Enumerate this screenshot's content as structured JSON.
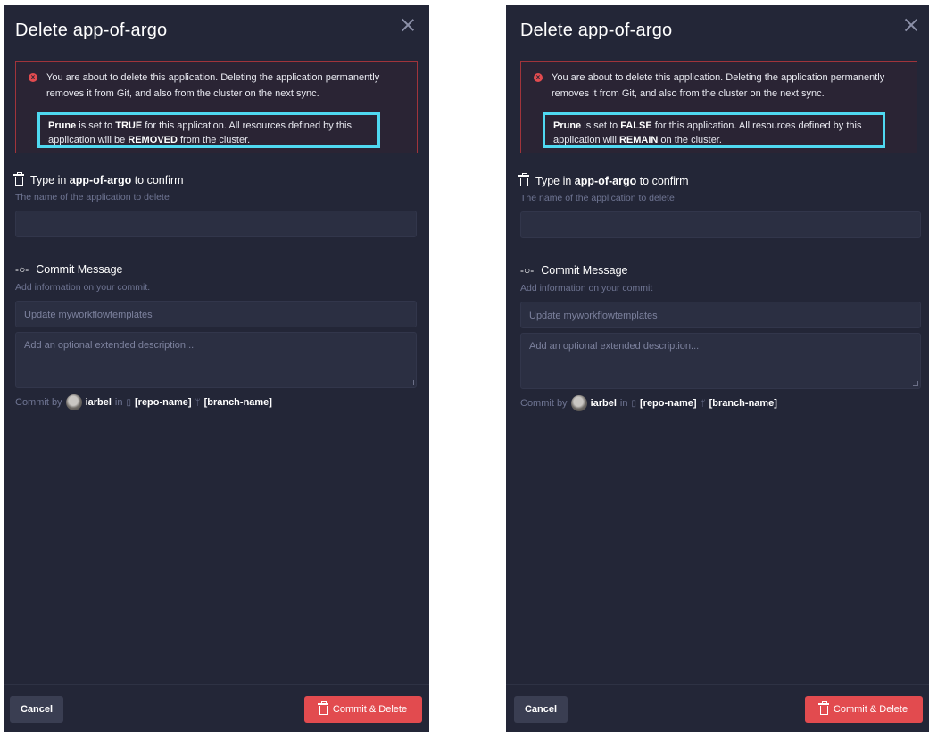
{
  "dialogs": [
    {
      "title": "Delete app-of-argo",
      "alert": {
        "message": "You are about to delete this application. Deleting the application permanently removes it from Git, and also from the cluster on the next sync.",
        "prune_label": "Prune",
        "prune_mid": " is set to ",
        "prune_value": "TRUE",
        "prune_after": " for this application. All resources defined by this application will be ",
        "prune_effect": "REMOVED",
        "prune_tail": " from the cluster."
      },
      "confirm": {
        "prefix": "Type in ",
        "app_name": "app-of-argo",
        "suffix": " to confirm",
        "hint": "The name of the application to delete",
        "value": ""
      },
      "commit": {
        "heading": "Commit Message",
        "hint": "Add information on your commit.",
        "summary_placeholder": "Update myworkflowtemplates",
        "description_placeholder": "Add an optional extended description...",
        "by_label": "Commit by",
        "user": "iarbel",
        "in_label": "in",
        "repo": "[repo-name]",
        "branch": "[branch-name]"
      },
      "footer": {
        "cancel": "Cancel",
        "commit_delete": "Commit & Delete"
      }
    },
    {
      "title": "Delete app-of-argo",
      "alert": {
        "message": "You are about to delete this application. Deleting the application permanently removes it from Git, and also from the cluster on the next sync.",
        "prune_label": "Prune",
        "prune_mid": " is set to ",
        "prune_value": "FALSE",
        "prune_after": " for this application. All resources defined by this application will ",
        "prune_effect": "REMAIN",
        "prune_tail": " on the cluster."
      },
      "confirm": {
        "prefix": "Type in ",
        "app_name": "app-of-argo",
        "suffix": " to confirm",
        "hint": "The name of the application to delete",
        "value": ""
      },
      "commit": {
        "heading": "Commit Message",
        "hint": "Add information on your commit",
        "summary_placeholder": "Update myworkflowtemplates",
        "description_placeholder": "Add an optional extended description...",
        "by_label": "Commit by",
        "user": "iarbel",
        "in_label": "in",
        "repo": "[repo-name]",
        "branch": "[branch-name]"
      },
      "footer": {
        "cancel": "Cancel",
        "commit_delete": "Commit & Delete"
      }
    }
  ],
  "colors": {
    "panel_bg": "#232637",
    "alert_border": "#a0343b",
    "highlight": "#4fd9f1",
    "danger": "#e24b4f"
  },
  "icons": [
    "close-icon",
    "error-icon",
    "trash-icon",
    "commit-icon",
    "avatar",
    "repo-icon",
    "branch-icon"
  ]
}
